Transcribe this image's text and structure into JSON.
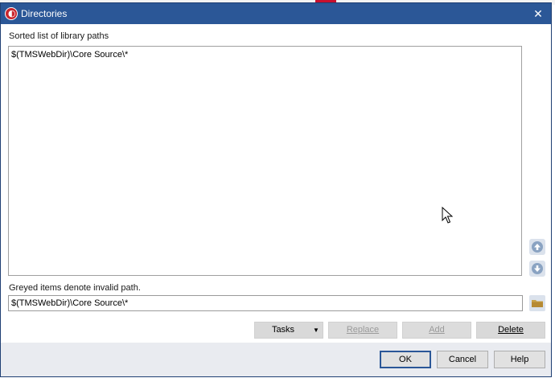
{
  "window": {
    "title": "Directories",
    "close_glyph": "✕"
  },
  "list": {
    "heading": "Sorted list of library paths",
    "items": [
      "$(TMSWebDir)\\Core Source\\*"
    ]
  },
  "hint": "Greyed items denote invalid path.",
  "path_input": {
    "value": "$(TMSWebDir)\\Core Source\\*"
  },
  "actions": {
    "tasks": "Tasks",
    "replace": "Replace",
    "add": "Add",
    "delete": "Delete"
  },
  "footer": {
    "ok": "OK",
    "cancel": "Cancel",
    "help": "Help"
  },
  "icons": {
    "move_up": "arrow-up-circle-icon",
    "move_down": "arrow-down-circle-icon",
    "browse": "folder-icon",
    "app": "delphi-helmet-icon",
    "tasks_dropdown": "caret-down-icon"
  },
  "colors": {
    "titlebar": "#2b5797",
    "footer": "#e9ebf0",
    "folder": "#c9a24a",
    "arrow_circle": "#8aa3c2"
  }
}
